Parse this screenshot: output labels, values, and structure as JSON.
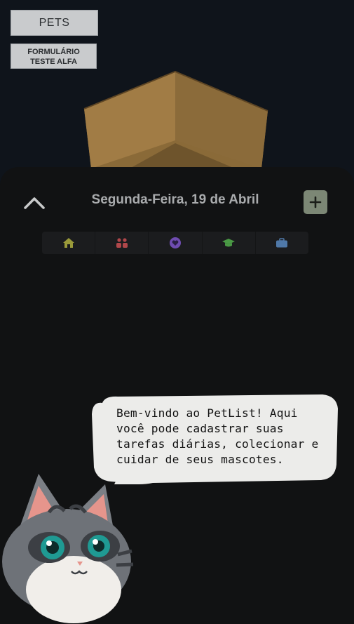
{
  "top_buttons": {
    "pets_label": "PETS",
    "form_label_line1": "FORMULÁRIO",
    "form_label_line2": "TESTE ALFA"
  },
  "header": {
    "date": "Segunda-Feira, 19 de Abril",
    "collapse_icon": "chevron-up-icon",
    "add_icon": "plus-icon"
  },
  "categories": [
    {
      "icon": "home-icon",
      "color": "#9a9a3a"
    },
    {
      "icon": "people-icon",
      "color": "#b0474a"
    },
    {
      "icon": "health-icon",
      "color": "#6f4cb0"
    },
    {
      "icon": "graduation-cap-icon",
      "color": "#4a9a45"
    },
    {
      "icon": "briefcase-icon",
      "color": "#4f78a8"
    }
  ],
  "tutorial": {
    "lines": [
      "Bem-vindo ao PetList! Aqui",
      "você pode cadastrar suas",
      "tarefas diárias, colecionar e",
      "cuidar de seus mascotes."
    ]
  },
  "colors": {
    "background": "#0f141b",
    "panel": "#111213",
    "accent_button": "#7c8775"
  }
}
